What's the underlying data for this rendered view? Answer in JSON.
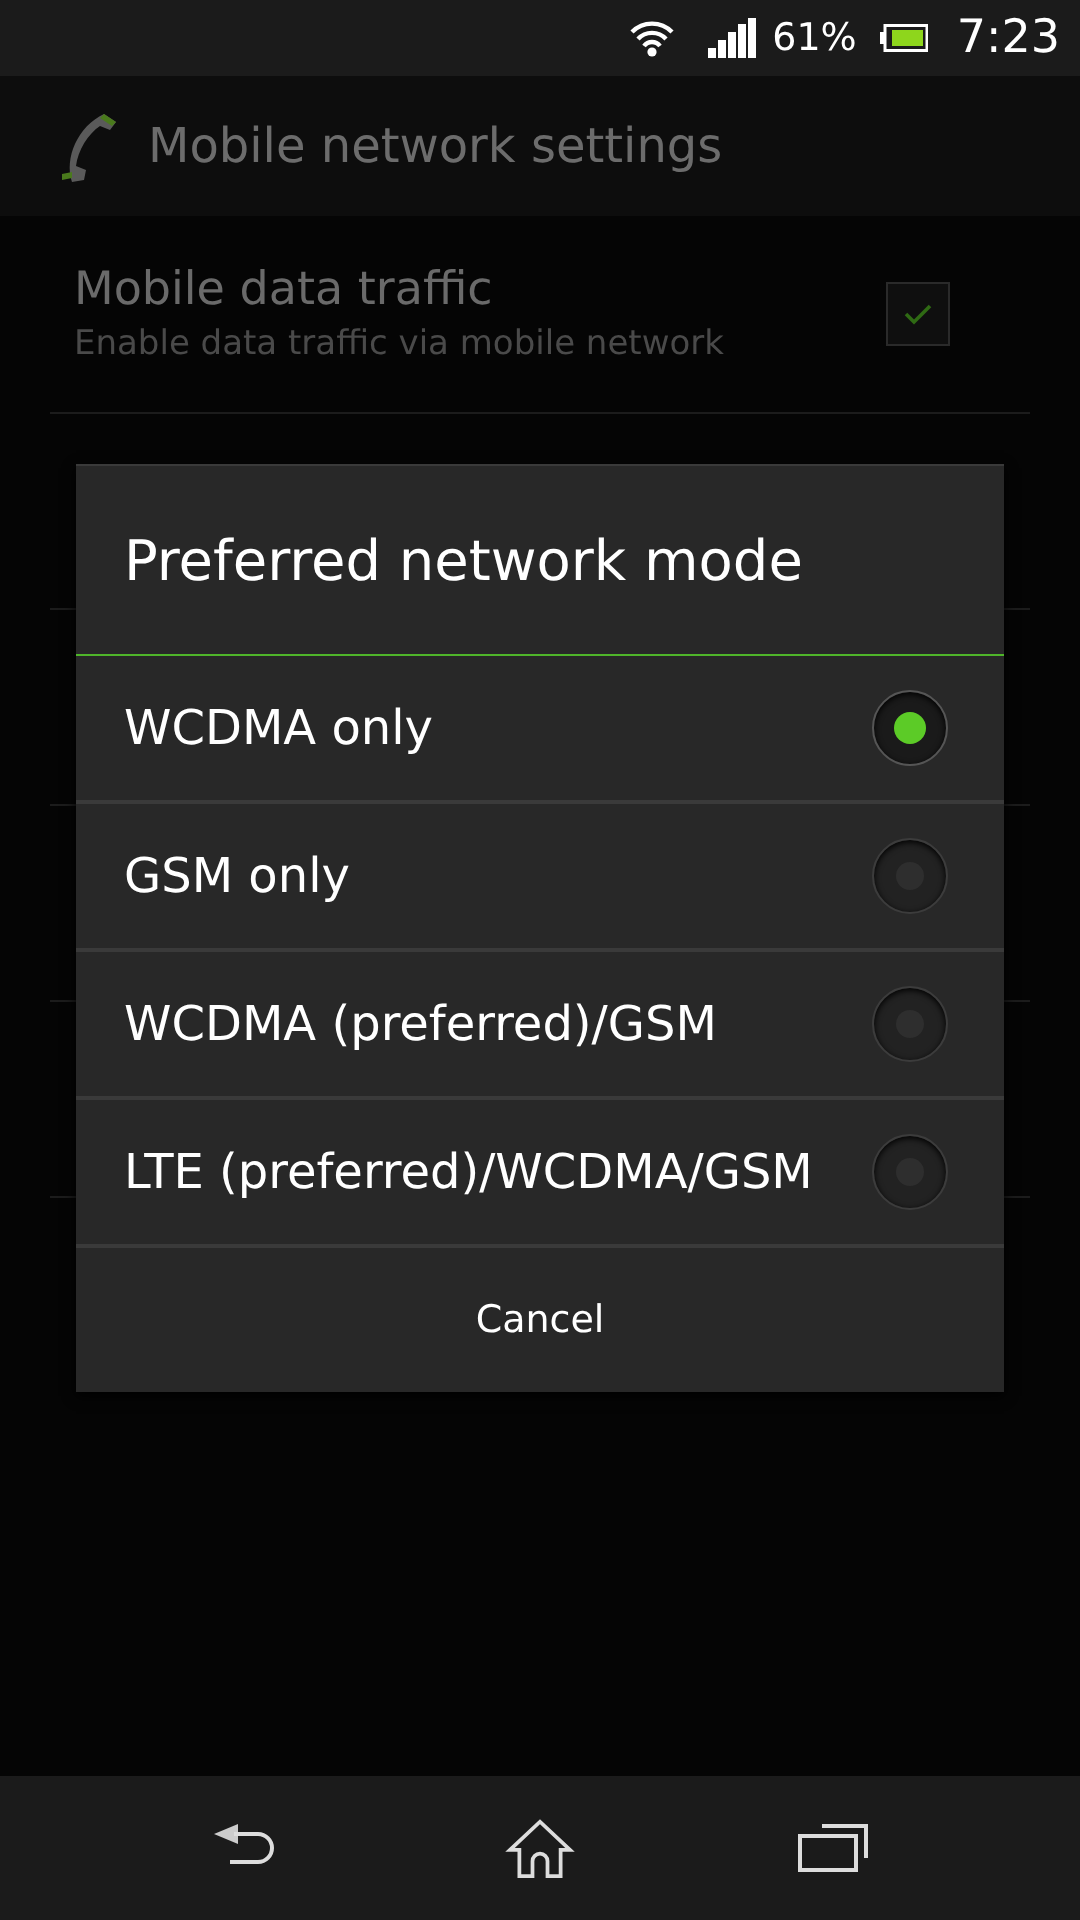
{
  "status_bar": {
    "battery": "61%",
    "time": "7:23"
  },
  "action_bar": {
    "title": "Mobile network settings"
  },
  "settings": [
    {
      "title": "Mobile data traffic",
      "summary": "Enable data traffic via mobile network",
      "checked": true
    }
  ],
  "dialog": {
    "title": "Preferred network mode",
    "options": [
      {
        "label": "WCDMA only",
        "selected": true
      },
      {
        "label": "GSM only",
        "selected": false
      },
      {
        "label": "WCDMA (preferred)/GSM",
        "selected": false
      },
      {
        "label": "LTE (preferred)/WCDMA/GSM",
        "selected": false
      }
    ],
    "cancel": "Cancel"
  }
}
